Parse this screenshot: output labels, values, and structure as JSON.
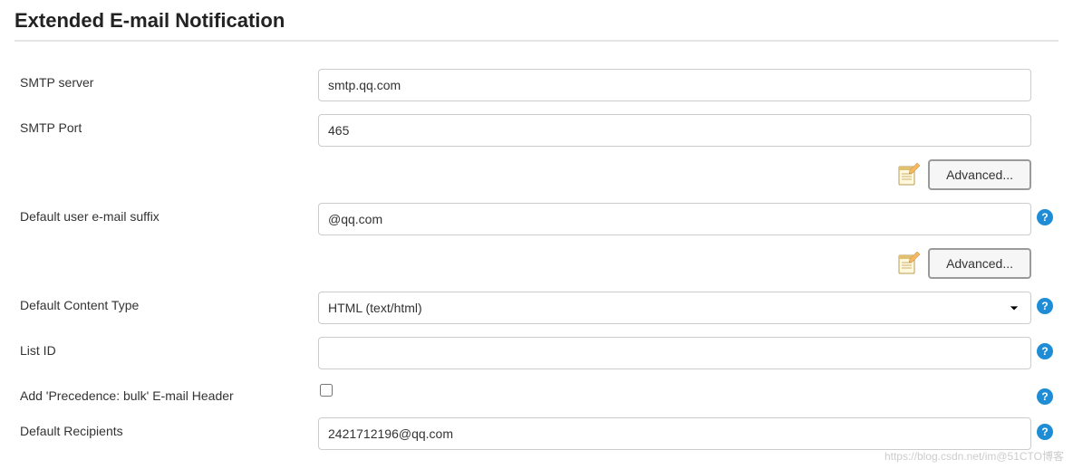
{
  "section_title": "Extended E-mail Notification",
  "fields": {
    "smtp_server": {
      "label": "SMTP server",
      "value": "smtp.qq.com"
    },
    "smtp_port": {
      "label": "SMTP Port",
      "value": "465"
    },
    "email_suffix": {
      "label": "Default user e-mail suffix",
      "value": "@qq.com"
    },
    "content_type": {
      "label": "Default Content Type",
      "value": "HTML (text/html)"
    },
    "list_id": {
      "label": "List ID",
      "value": ""
    },
    "precedence": {
      "label": "Add 'Precedence: bulk' E-mail Header",
      "checked": false
    },
    "recipients": {
      "label": "Default Recipients",
      "value": "2421712196@qq.com"
    }
  },
  "buttons": {
    "advanced": "Advanced..."
  },
  "watermark": "https://blog.csdn.net/im@51CTO博客"
}
